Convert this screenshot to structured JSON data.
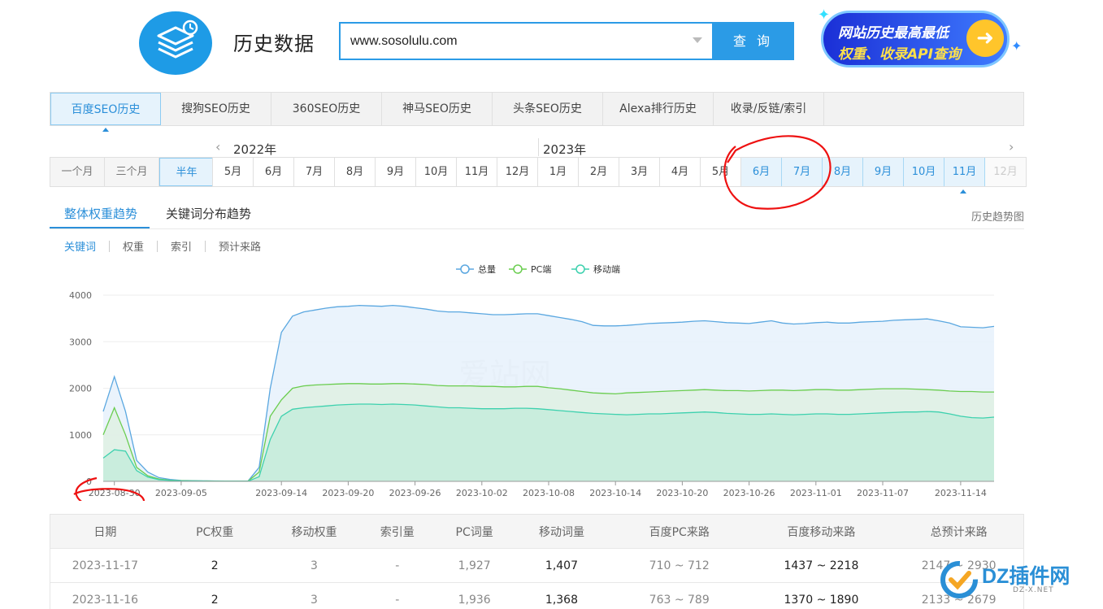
{
  "header": {
    "title": "历史数据",
    "search_value": "www.sosolulu.com",
    "search_button": "查 询",
    "promo_line1": "网站历史最高最低",
    "promo_line2": "权重、收录API查询"
  },
  "top_tabs": [
    "百度SEO历史",
    "搜狗SEO历史",
    "360SEO历史",
    "神马SEO历史",
    "头条SEO历史",
    "Alexa排行历史",
    "收录/反链/索引"
  ],
  "active_top_tab": 0,
  "range": {
    "options": [
      "一个月",
      "三个月",
      "半年"
    ],
    "active": 2
  },
  "years": {
    "y2022": "2022年",
    "y2023": "2023年"
  },
  "months": [
    {
      "label": "5月",
      "state": "normal"
    },
    {
      "label": "6月",
      "state": "normal"
    },
    {
      "label": "7月",
      "state": "normal"
    },
    {
      "label": "8月",
      "state": "normal"
    },
    {
      "label": "9月",
      "state": "normal"
    },
    {
      "label": "10月",
      "state": "normal"
    },
    {
      "label": "11月",
      "state": "normal"
    },
    {
      "label": "12月",
      "state": "normal"
    },
    {
      "label": "1月",
      "state": "normal"
    },
    {
      "label": "2月",
      "state": "normal"
    },
    {
      "label": "3月",
      "state": "normal"
    },
    {
      "label": "4月",
      "state": "normal"
    },
    {
      "label": "5月",
      "state": "normal"
    },
    {
      "label": "6月",
      "state": "sel"
    },
    {
      "label": "7月",
      "state": "sel"
    },
    {
      "label": "8月",
      "state": "sel"
    },
    {
      "label": "9月",
      "state": "sel"
    },
    {
      "label": "10月",
      "state": "sel"
    },
    {
      "label": "11月",
      "state": "sel"
    },
    {
      "label": "12月",
      "state": "dis"
    }
  ],
  "sub_tabs": {
    "overall": "整体权重趋势",
    "keyword_dist": "关键词分布趋势",
    "history_chart": "历史趋势图"
  },
  "metric_tabs": [
    "关键词",
    "权重",
    "索引",
    "预计来路"
  ],
  "chart_data": {
    "type": "area",
    "title": "",
    "legend_position": "top-center",
    "ylim": [
      0,
      4000
    ],
    "yticks": [
      0,
      1000,
      2000,
      3000,
      4000
    ],
    "xtick_labels": [
      "2023-08-30",
      "2023-09-05",
      "2023-09-14",
      "2023-09-20",
      "2023-09-26",
      "2023-10-02",
      "2023-10-08",
      "2023-10-14",
      "2023-10-20",
      "2023-10-26",
      "2023-11-01",
      "2023-11-07",
      "2023-11-14"
    ],
    "x": [
      "08-29",
      "08-30",
      "08-31",
      "09-01",
      "09-02",
      "09-03",
      "09-04",
      "09-05",
      "09-06",
      "09-07",
      "09-08",
      "09-09",
      "09-10",
      "09-11",
      "09-12",
      "09-13",
      "09-14",
      "09-15",
      "09-16",
      "09-17",
      "09-18",
      "09-19",
      "09-20",
      "09-21",
      "09-22",
      "09-23",
      "09-24",
      "09-25",
      "09-26",
      "09-27",
      "09-28",
      "09-29",
      "09-30",
      "10-01",
      "10-02",
      "10-03",
      "10-04",
      "10-05",
      "10-06",
      "10-07",
      "10-08",
      "10-09",
      "10-10",
      "10-11",
      "10-12",
      "10-13",
      "10-14",
      "10-15",
      "10-16",
      "10-17",
      "10-18",
      "10-19",
      "10-20",
      "10-21",
      "10-22",
      "10-23",
      "10-24",
      "10-25",
      "10-26",
      "10-27",
      "10-28",
      "10-29",
      "10-30",
      "10-31",
      "11-01",
      "11-02",
      "11-03",
      "11-04",
      "11-05",
      "11-06",
      "11-07",
      "11-08",
      "11-09",
      "11-10",
      "11-11",
      "11-12",
      "11-13",
      "11-14",
      "11-15",
      "11-16",
      "11-17"
    ],
    "series": [
      {
        "name": "总量",
        "color": "#5aa7e0",
        "fill": "#e6f1fb",
        "values": [
          1500,
          2250,
          1500,
          450,
          200,
          80,
          40,
          20,
          15,
          10,
          8,
          5,
          5,
          5,
          300,
          2000,
          3200,
          3550,
          3640,
          3680,
          3720,
          3750,
          3760,
          3780,
          3770,
          3760,
          3780,
          3760,
          3730,
          3700,
          3660,
          3640,
          3640,
          3620,
          3600,
          3580,
          3580,
          3590,
          3600,
          3600,
          3560,
          3520,
          3480,
          3430,
          3350,
          3340,
          3340,
          3350,
          3370,
          3390,
          3400,
          3410,
          3420,
          3440,
          3450,
          3430,
          3410,
          3400,
          3390,
          3420,
          3450,
          3400,
          3380,
          3390,
          3410,
          3420,
          3400,
          3400,
          3420,
          3430,
          3440,
          3460,
          3470,
          3480,
          3490,
          3450,
          3400,
          3320,
          3310,
          3300,
          3330
        ]
      },
      {
        "name": "PC端",
        "color": "#6acd4f",
        "fill": "#dff0e3",
        "values": [
          1000,
          1580,
          1000,
          300,
          120,
          50,
          25,
          15,
          10,
          8,
          6,
          4,
          4,
          4,
          200,
          1400,
          1750,
          2000,
          2050,
          2070,
          2080,
          2090,
          2100,
          2100,
          2090,
          2090,
          2100,
          2100,
          2090,
          2080,
          2060,
          2050,
          2050,
          2050,
          2040,
          2040,
          2030,
          2030,
          2040,
          2040,
          2010,
          1990,
          1960,
          1930,
          1900,
          1890,
          1880,
          1900,
          1910,
          1920,
          1930,
          1940,
          1950,
          1960,
          1970,
          1960,
          1950,
          1950,
          1940,
          1950,
          1960,
          1960,
          1950,
          1960,
          1970,
          1970,
          1960,
          1960,
          1970,
          1980,
          1990,
          1990,
          1990,
          1980,
          1970,
          1960,
          1940,
          1930,
          1930,
          1920,
          1920
        ]
      },
      {
        "name": "移动端",
        "color": "#3dd1ae",
        "fill": "#c4ecda",
        "values": [
          500,
          680,
          650,
          230,
          90,
          35,
          20,
          10,
          8,
          6,
          4,
          3,
          3,
          3,
          100,
          900,
          1400,
          1550,
          1580,
          1600,
          1620,
          1640,
          1650,
          1660,
          1660,
          1650,
          1660,
          1650,
          1640,
          1620,
          1600,
          1580,
          1580,
          1570,
          1560,
          1560,
          1560,
          1570,
          1570,
          1560,
          1540,
          1520,
          1500,
          1480,
          1460,
          1450,
          1440,
          1430,
          1440,
          1450,
          1450,
          1460,
          1470,
          1480,
          1490,
          1480,
          1460,
          1450,
          1440,
          1440,
          1450,
          1440,
          1430,
          1440,
          1450,
          1450,
          1440,
          1440,
          1450,
          1460,
          1470,
          1480,
          1490,
          1490,
          1500,
          1490,
          1450,
          1400,
          1370,
          1360,
          1380
        ]
      }
    ]
  },
  "table": {
    "headers": [
      "日期",
      "PC权重",
      "移动权重",
      "索引量",
      "PC词量",
      "移动词量",
      "百度PC来路",
      "百度移动来路",
      "总预计来路"
    ],
    "rows": [
      [
        "2023-11-17",
        "2",
        "3",
        "-",
        "1,927",
        "1,407",
        "710 ~ 712",
        "1437 ~ 2218",
        "2147 ~ 2930"
      ],
      [
        "2023-11-16",
        "2",
        "3",
        "-",
        "1,936",
        "1,368",
        "763 ~ 789",
        "1370 ~ 1890",
        "2133 ~ 2679"
      ]
    ]
  },
  "watermark": "爱站网",
  "dz_logo": {
    "text": "DZ插件网",
    "sub": "DZ-X.NET"
  }
}
